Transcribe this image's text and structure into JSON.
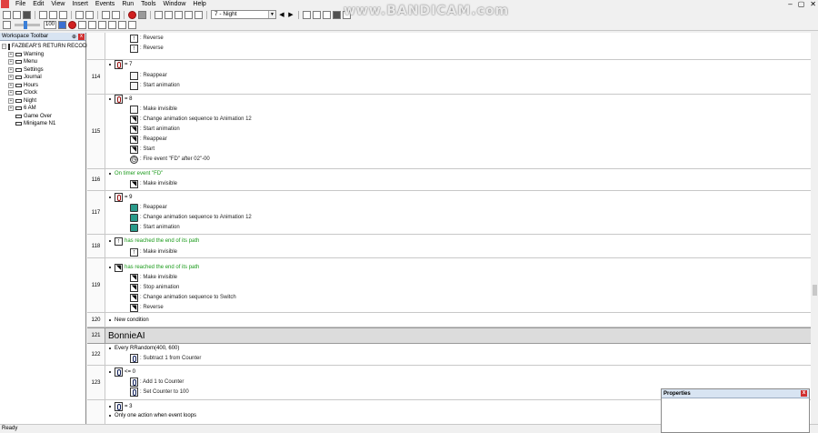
{
  "watermark": "www.BANDICAM.com",
  "menubar": {
    "items": [
      "File",
      "Edit",
      "View",
      "Insert",
      "Events",
      "Run",
      "Tools",
      "Window",
      "Help"
    ],
    "controls": [
      "–",
      "▢",
      "✕"
    ]
  },
  "toolbar": {
    "frame_select": "7 - Night",
    "zoom_value": "100"
  },
  "workspace": {
    "title": "Workspace Toolbar",
    "pin": "⊕",
    "close": "x",
    "app_name": "FAZBEAR'S RETURN RECODED",
    "frames": [
      "Warning",
      "Menu",
      "Settings",
      "Journal",
      "Hours",
      "Clock",
      "Night",
      "6 AM",
      "Game Over",
      "Minigame N1"
    ]
  },
  "events": {
    "r114": {
      "num": "114",
      "cond": "= 7",
      "a1": ": Reappear",
      "a2": ": Start animation"
    },
    "r115": {
      "num": "115",
      "cond": "= 8",
      "a1": ": Make invisible",
      "a2": ": Change animation sequence to Animation 12",
      "a3": ": Start animation",
      "a4": ": Reappear",
      "a5": ": Start",
      "a6": ": Fire event \"FD\" after 02\"-00"
    },
    "r116": {
      "num": "116",
      "cond": "On timer event \"FD\"",
      "a1": ": Make invisible"
    },
    "r117": {
      "num": "117",
      "cond": "= 9",
      "a1": ": Reappear",
      "a2": ": Change animation sequence to Animation 12",
      "a3": ": Start animation"
    },
    "r118": {
      "num": "118",
      "cond": "has reached the end of its path",
      "a1": ": Make invisible"
    },
    "r119": {
      "num": "119",
      "cond": "has reached the end of its path",
      "a1": ": Make invisible",
      "a2": ": Stop animation",
      "a3": ": Change animation sequence to Switch",
      "a4": ": Reverse"
    },
    "r120": {
      "num": "120",
      "text": "New condition"
    },
    "group": {
      "num": "121",
      "title": "BonnieAI"
    },
    "r122": {
      "num": "122",
      "cond": "Every RRandom(400, 600)",
      "a1": ": Subtract 1 from Counter"
    },
    "r123": {
      "num": "123",
      "cond": "<= 0",
      "a1": ": Add 1 to Counter",
      "a2": ": Set Counter to 100"
    },
    "r124": {
      "cond": "= 3",
      "cond2": "Only one action when event loops"
    },
    "top": {
      "a1": ": Reverse",
      "a2": ": Reverse"
    }
  },
  "properties": {
    "title": "Properties",
    "close": "x"
  },
  "status": "Ready"
}
